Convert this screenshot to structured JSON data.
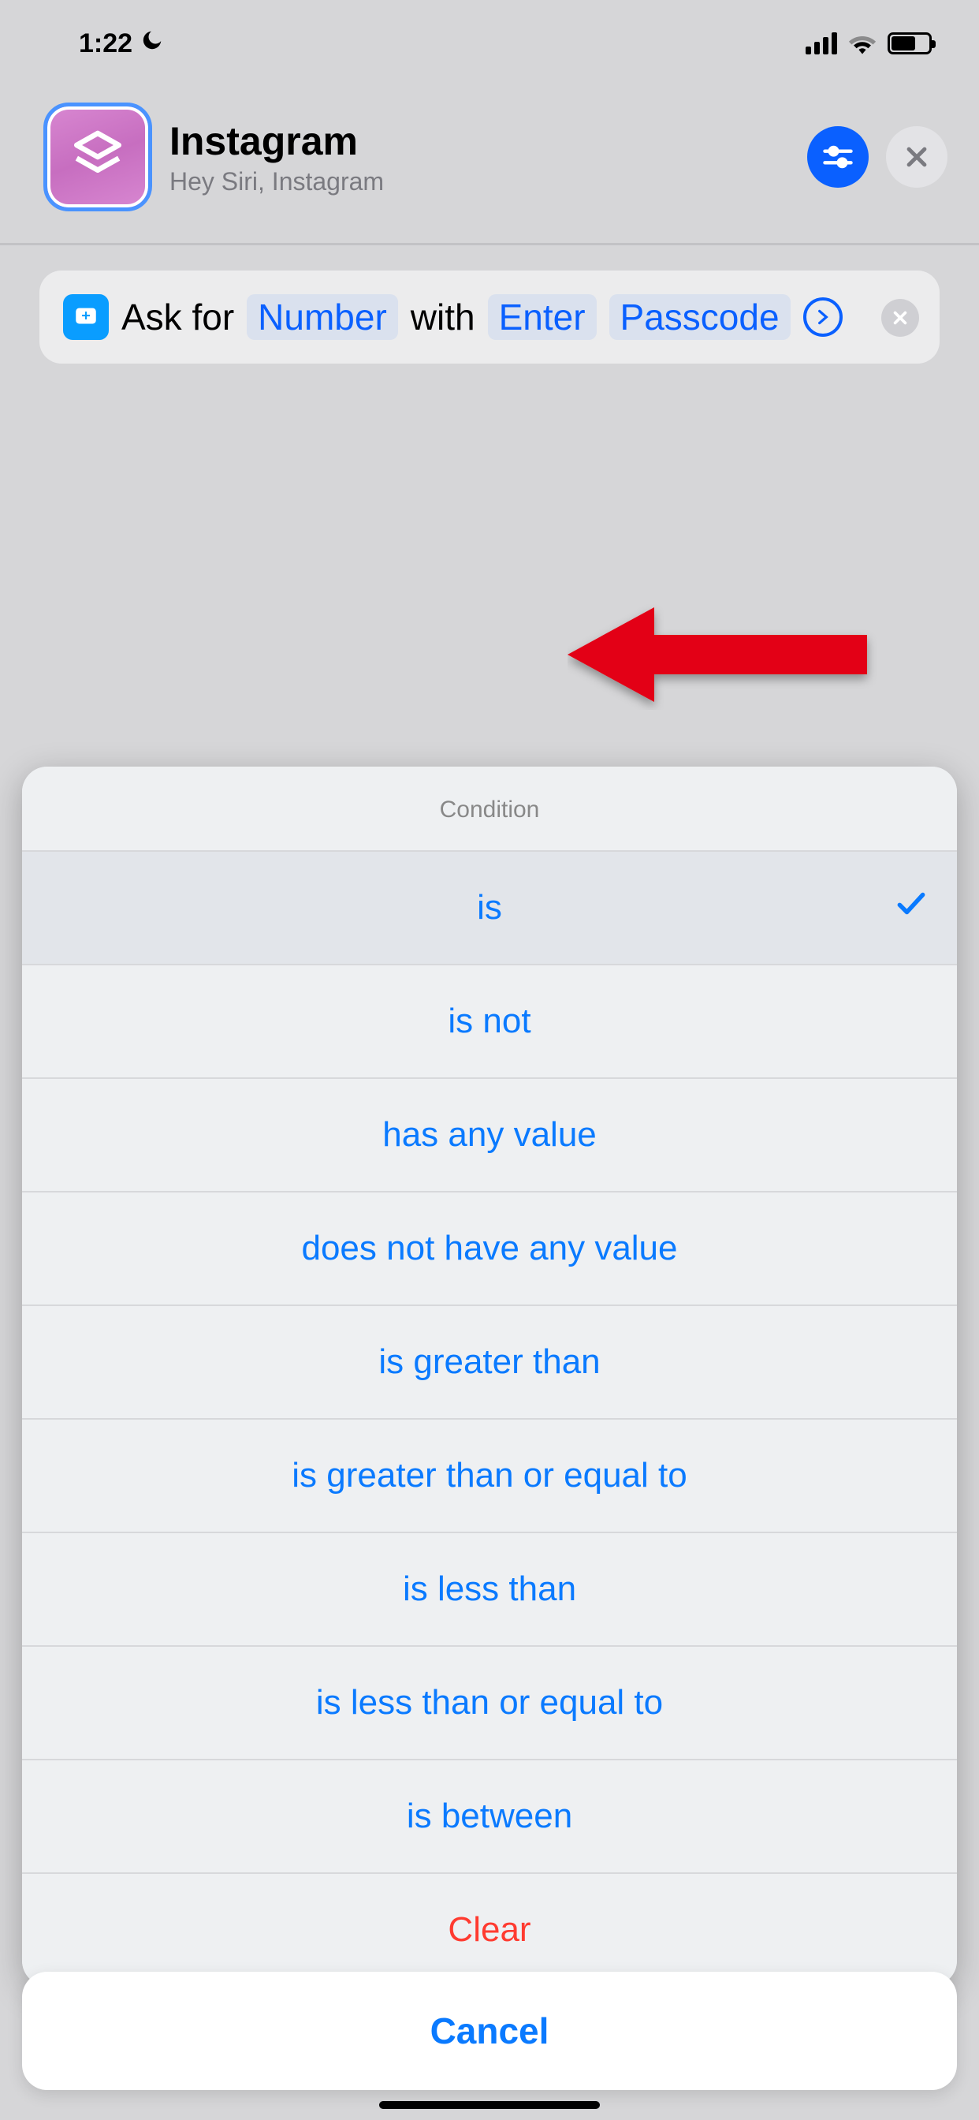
{
  "status": {
    "time": "1:22"
  },
  "header": {
    "title": "Instagram",
    "subtitle": "Hey Siri, Instagram"
  },
  "action": {
    "text1": "Ask for",
    "token1": "Number",
    "text2": "with",
    "token2": "Enter",
    "token3": "Passcode"
  },
  "sheet": {
    "title": "Condition",
    "options": {
      "o0": "is",
      "o1": "is not",
      "o2": "has any value",
      "o3": "does not have any value",
      "o4": "is greater than",
      "o5": "is greater than or equal to",
      "o6": "is less than",
      "o7": "is less than or equal to",
      "o8": "is between"
    },
    "clear": "Clear",
    "cancel": "Cancel"
  }
}
